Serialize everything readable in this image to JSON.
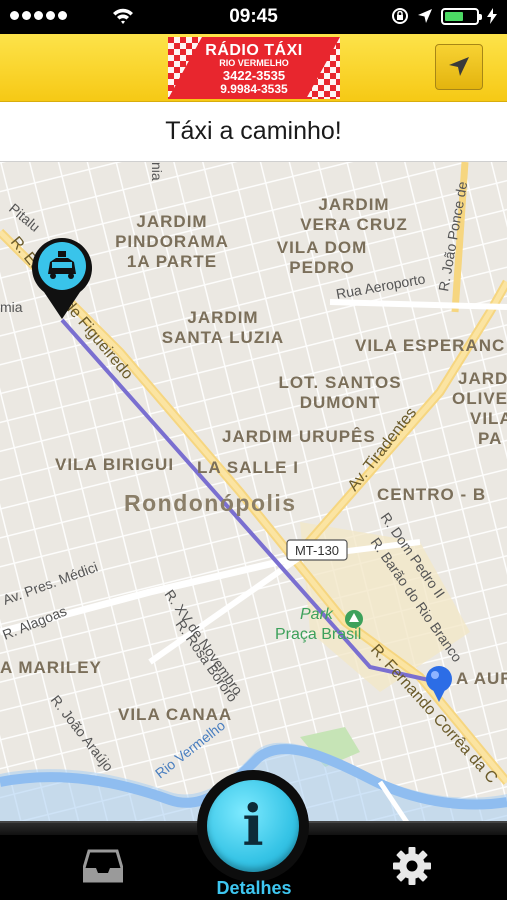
{
  "status_bar": {
    "time": "09:45",
    "battery_level": 0.6
  },
  "header": {
    "logo": {
      "line1": "RÁDIO TÁXI",
      "line2": "RIO VERMELHO",
      "line3": "3422-3535",
      "line4": "9.9984-3535"
    },
    "location_button_icon": "navigation-arrow-icon"
  },
  "banner": {
    "status": "Táxi a caminho!"
  },
  "map": {
    "labels": {
      "jardim_pindorama": [
        "JARDIM",
        "PINDORAMA",
        "1A PARTE"
      ],
      "jardim_vera_cruz": [
        "JARDIM",
        "VERA CRUZ"
      ],
      "vila_dom_pedro": [
        "VILA DOM",
        "PEDRO"
      ],
      "jardim_santa_luzia": [
        "JARDIM",
        "SANTA LUZIA"
      ],
      "vila_esperanca": "VILA ESPERANC",
      "lot_santos_dumont": [
        "LOT. SANTOS",
        "DUMONT"
      ],
      "jardim_olive": [
        "JARD",
        "OLIVE"
      ],
      "vila_pa": [
        "VILA",
        "PA"
      ],
      "jardim_urupes": "JARDIM URUPÊS",
      "vila_birigui": "VILA BIRIGUI",
      "la_salle": "LA SALLE I",
      "centro": "CENTRO - B",
      "city": "Rondonópolis",
      "marily": "A MARILEY",
      "vila_canaa": "VILA CANAA",
      "a_aur": "A AUR",
      "park": "Park",
      "praca_brasil": "Praça Brasil",
      "highway": "MT-130",
      "rua_aeroporto": "Rua Aeroporto",
      "r_joao_ponce": "R. João Ponce de",
      "r_estevao": "R. Estevão de Figueiredo",
      "av_tiradentes": "Av. Tiradentes",
      "r_dom_pedro": "R. Dom Pedro II",
      "r_barao": "R. Barão do Rio Branco",
      "av_pres_medici": "Av. Pres. Médici",
      "r_alagoas": "R. Alagoas",
      "r_xv": "R. XV de Novembro",
      "r_rosa": "R. Rosa Bororó",
      "r_fernando": "R. Fernando Corrêa da C",
      "r_joao_araujo": "R. João Araújo",
      "rio_vermelho": "Rio Vermelho",
      "r_pitalu": "Pitalu",
      "mia": "mia",
      "nia": "nia"
    }
  },
  "tab_bar": {
    "inbox_icon": "inbox-tray-icon",
    "details_label": "Detalhes",
    "settings_icon": "gear-icon"
  },
  "colors": {
    "header_yellow": "#f8d22a",
    "accent_blue": "#3ec6f0",
    "route": "#7a6fd0"
  }
}
